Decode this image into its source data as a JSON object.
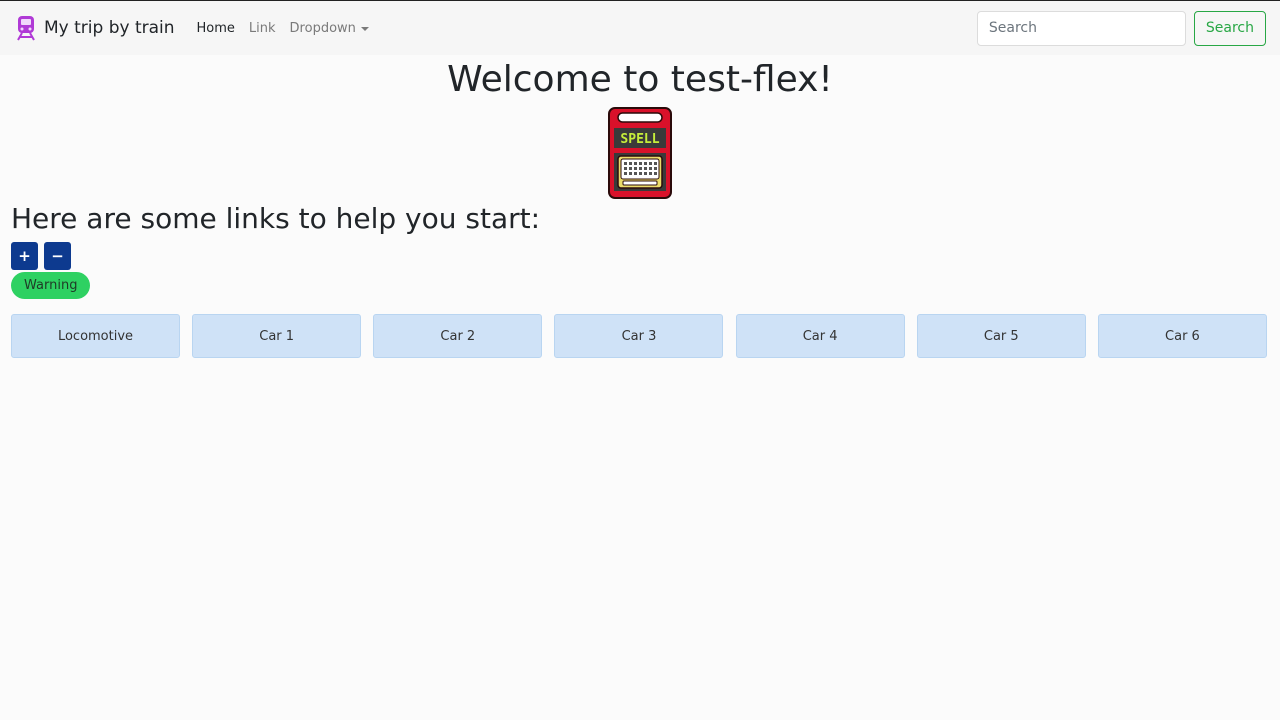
{
  "navbar": {
    "brand": "My trip by train",
    "links": [
      {
        "label": "Home"
      },
      {
        "label": "Link"
      },
      {
        "label": "Dropdown"
      }
    ],
    "search": {
      "placeholder": "Search",
      "button_label": "Search"
    }
  },
  "main": {
    "title": "Welcome to test-flex!",
    "subtitle": "Here are some links to help you start:",
    "counter": {
      "plus_label": "+",
      "minus_label": "−"
    },
    "badge": "Warning",
    "cars": [
      "Locomotive",
      "Car 1",
      "Car 2",
      "Car 3",
      "Car 4",
      "Car 5",
      "Car 6"
    ]
  },
  "logo": {
    "text": "SPELL"
  },
  "colors": {
    "accent_green": "#28a745",
    "counter_blue": "#0d3a8f",
    "badge_green": "#2ed162",
    "car_fill": "#cfe2f7"
  }
}
